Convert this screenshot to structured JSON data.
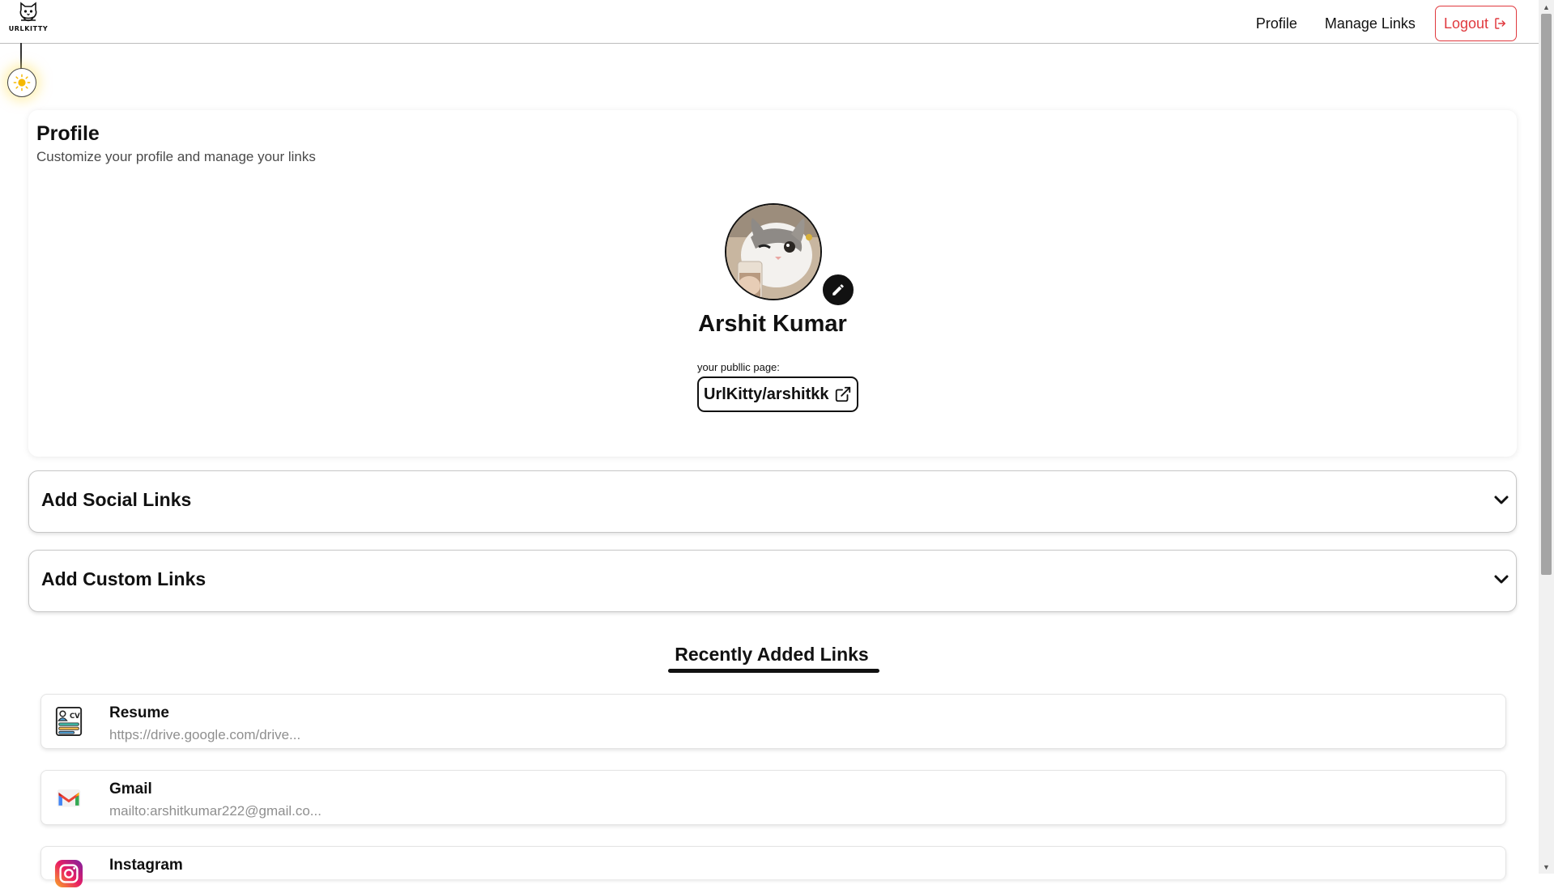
{
  "app": {
    "logo_text": "URLKITTY"
  },
  "nav": {
    "profile": "Profile",
    "manage_links": "Manage Links",
    "logout": "Logout"
  },
  "profile": {
    "title": "Profile",
    "subtitle": "Customize your profile and manage your links",
    "display_name": "Arshit Kumar",
    "public_label": "your publlic page:",
    "public_link": "UrlKitty/arshitkk"
  },
  "accordions": {
    "social": "Add Social Links",
    "custom": "Add Custom Links"
  },
  "recent": {
    "title": "Recently Added Links",
    "items": [
      {
        "name": "Resume",
        "url": "https://drive.google.com/drive...",
        "icon": "resume-cv-icon"
      },
      {
        "name": "Gmail",
        "url": "mailto:arshitkumar222@gmail.co...",
        "icon": "gmail-icon"
      },
      {
        "name": "Instagram",
        "url": "",
        "icon": "instagram-icon"
      }
    ]
  },
  "colors": {
    "logout": "#e0393e",
    "accent": "#111111",
    "muted": "#8f8f8f"
  }
}
